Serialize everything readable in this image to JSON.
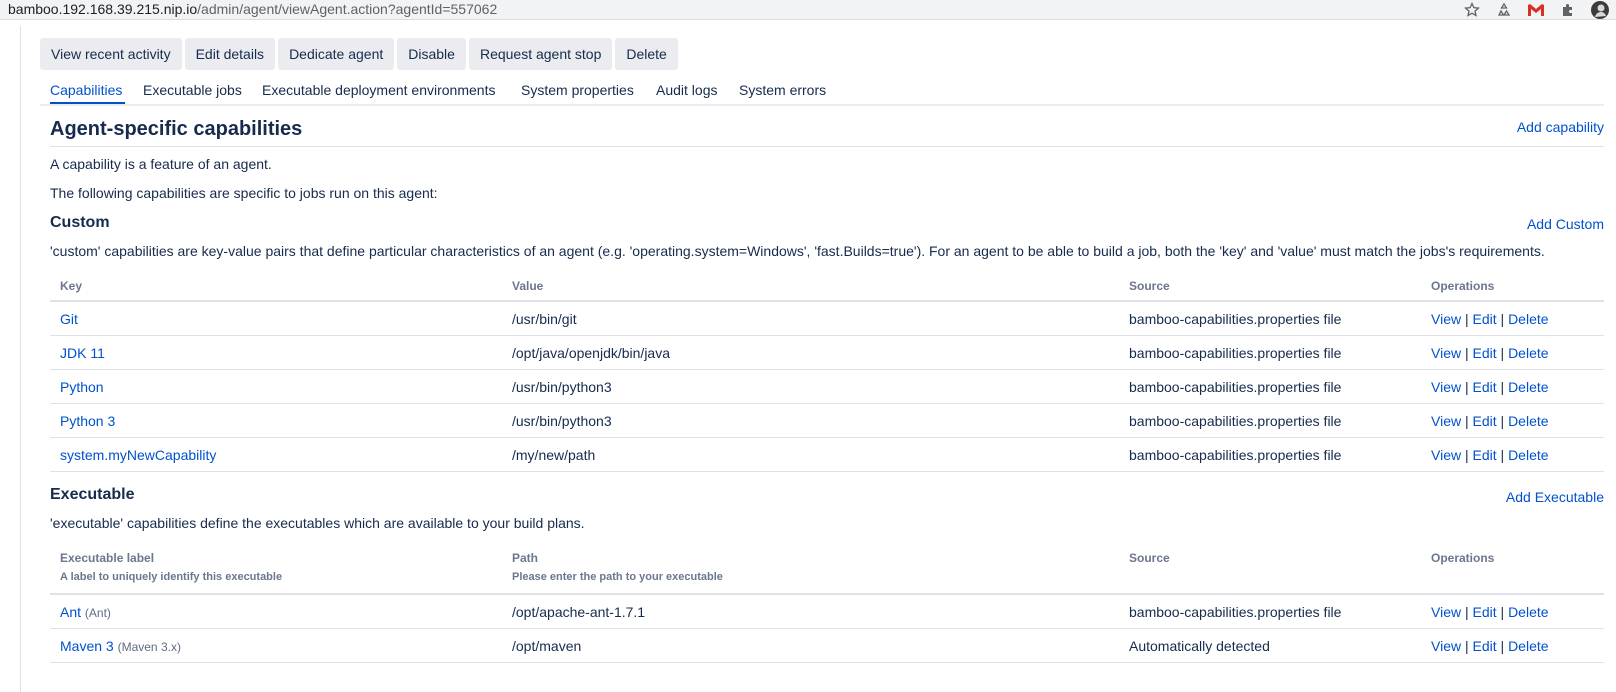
{
  "browser": {
    "url_host": "bamboo.192.168.39.215.nip.io",
    "url_path": "/admin/agent/viewAgent.action?agentId=557062",
    "icons": [
      "star-icon",
      "recycle-icon",
      "gmail-icon",
      "puzzle-icon",
      "profile-avatar"
    ]
  },
  "actions": [
    "View recent activity",
    "Edit details",
    "Dedicate agent",
    "Disable",
    "Request agent stop",
    "Delete"
  ],
  "tabs": [
    "Capabilities",
    "Executable jobs",
    "Executable deployment environments",
    "System properties",
    "Audit logs",
    "System errors"
  ],
  "active_tab": "Capabilities",
  "page": {
    "title": "Agent-specific capabilities",
    "add_capability": "Add capability",
    "intro1": "A capability is a feature of an agent.",
    "intro2": "The following capabilities are specific to jobs run on this agent:"
  },
  "custom": {
    "heading": "Custom",
    "add_label": "Add Custom",
    "description": "'custom' capabilities are key-value pairs that define particular characteristics of an agent (e.g. 'operating.system=Windows', 'fast.Builds=true'). For an agent to be able to build a job, both the 'key' and 'value' must match the jobs's requirements.",
    "columns": [
      "Key",
      "Value",
      "Source",
      "Operations"
    ],
    "rows": [
      {
        "key": "Git",
        "value": "/usr/bin/git",
        "source": "bamboo-capabilities.properties file"
      },
      {
        "key": "JDK 11",
        "value": "/opt/java/openjdk/bin/java",
        "source": "bamboo-capabilities.properties file"
      },
      {
        "key": "Python",
        "value": "/usr/bin/python3",
        "source": "bamboo-capabilities.properties file"
      },
      {
        "key": "Python 3",
        "value": "/usr/bin/python3",
        "source": "bamboo-capabilities.properties file"
      },
      {
        "key": "system.myNewCapability",
        "value": "/my/new/path",
        "source": "bamboo-capabilities.properties file"
      }
    ]
  },
  "executable": {
    "heading": "Executable",
    "add_label": "Add Executable",
    "description": "'executable' capabilities define the executables which are available to your build plans.",
    "columns": [
      "Executable label",
      "Path",
      "Source",
      "Operations"
    ],
    "column_hints": [
      "A label to uniquely identify this executable",
      "Please enter the path to your executable"
    ],
    "rows": [
      {
        "label": "Ant",
        "type": "(Ant)",
        "path": "/opt/apache-ant-1.7.1",
        "source": "bamboo-capabilities.properties file"
      },
      {
        "label": "Maven 3",
        "type": "(Maven 3.x)",
        "path": "/opt/maven",
        "source": "Automatically detected"
      }
    ]
  },
  "operations": {
    "view": "View",
    "edit": "Edit",
    "delete": "Delete",
    "separator": "|"
  },
  "colors": {
    "link": "#0052cc",
    "text": "#172b4d",
    "muted": "#6b778c",
    "button_bg": "#ebecf0",
    "border": "#dfe1e6"
  }
}
